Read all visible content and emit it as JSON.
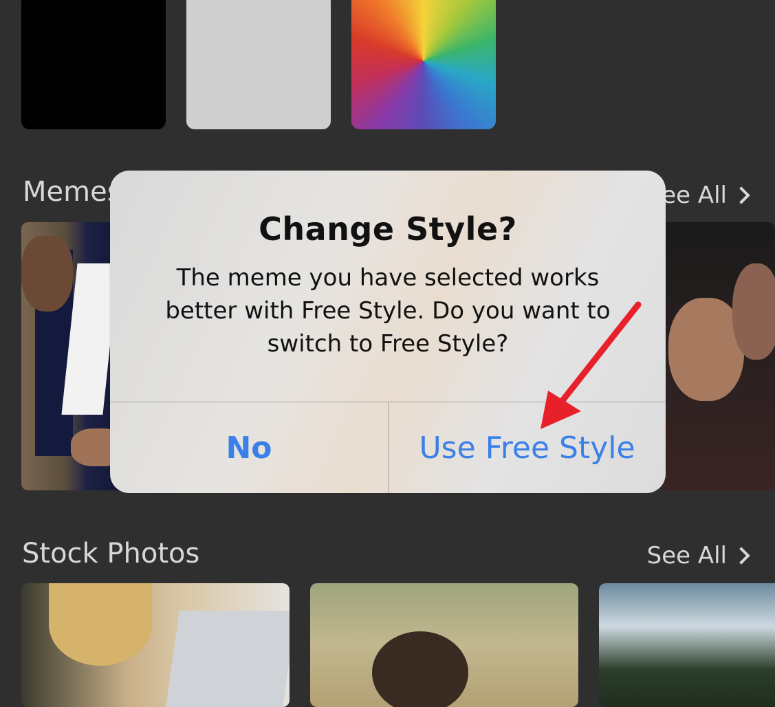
{
  "sections": {
    "memes": {
      "title": "Memes",
      "see_all": "See All"
    },
    "stock_photos": {
      "title": "Stock Photos",
      "see_all": "See All"
    }
  },
  "dialog": {
    "title": "Change Style?",
    "message": "The meme you have selected works better with Free Style. Do you want to switch to Free Style?",
    "buttons": {
      "no": "No",
      "use_free_style": "Use Free Style"
    }
  },
  "colors": {
    "button_text": "#3a80e8",
    "arrow": "#e8202a",
    "background": "#2f2f2f"
  }
}
